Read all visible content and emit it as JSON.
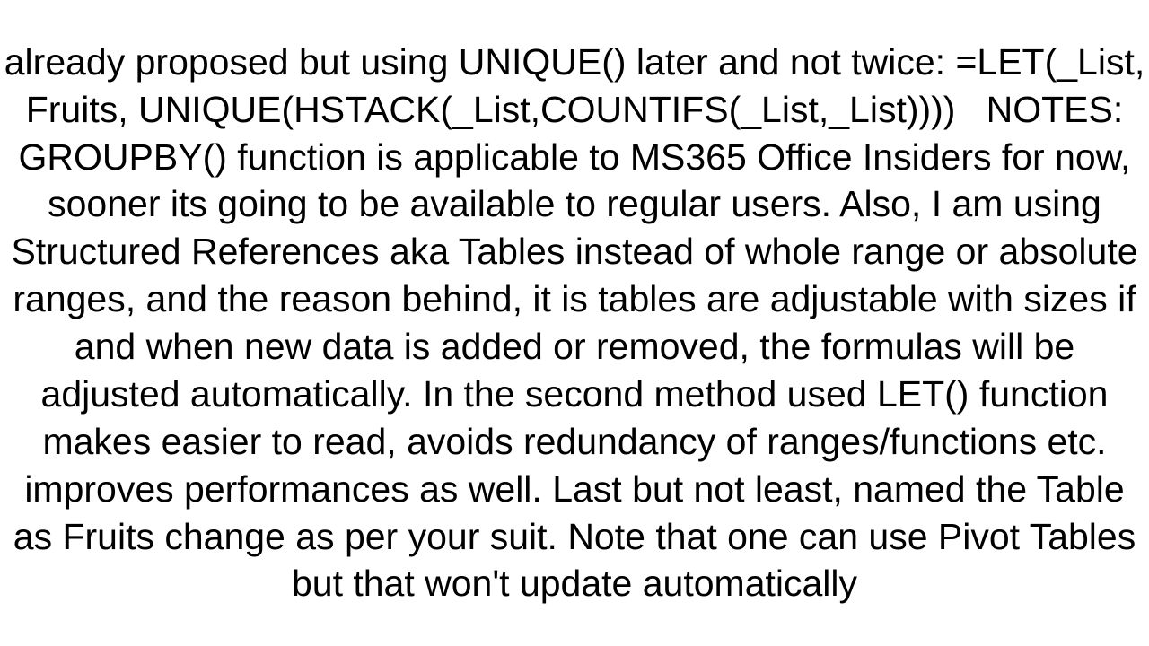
{
  "document": {
    "body_text": "already proposed but using UNIQUE() later and not twice: =LET(_List, Fruits, UNIQUE(HSTACK(_List,COUNTIFS(_List,_List))))   NOTES: GROUPBY() function is applicable to MS365 Office Insiders for now, sooner its going to be available to regular users. Also, I am using Structured References aka Tables instead of whole range or absolute ranges, and the reason behind, it is tables are adjustable with sizes if and when new data is added or removed, the formulas will be adjusted automatically. In the second method used LET() function makes easier to read, avoids redundancy of ranges/functions etc. improves performances as well. Last but not least, named the Table as Fruits change as per your suit. Note that one can use Pivot Tables but that won't update automatically"
  }
}
